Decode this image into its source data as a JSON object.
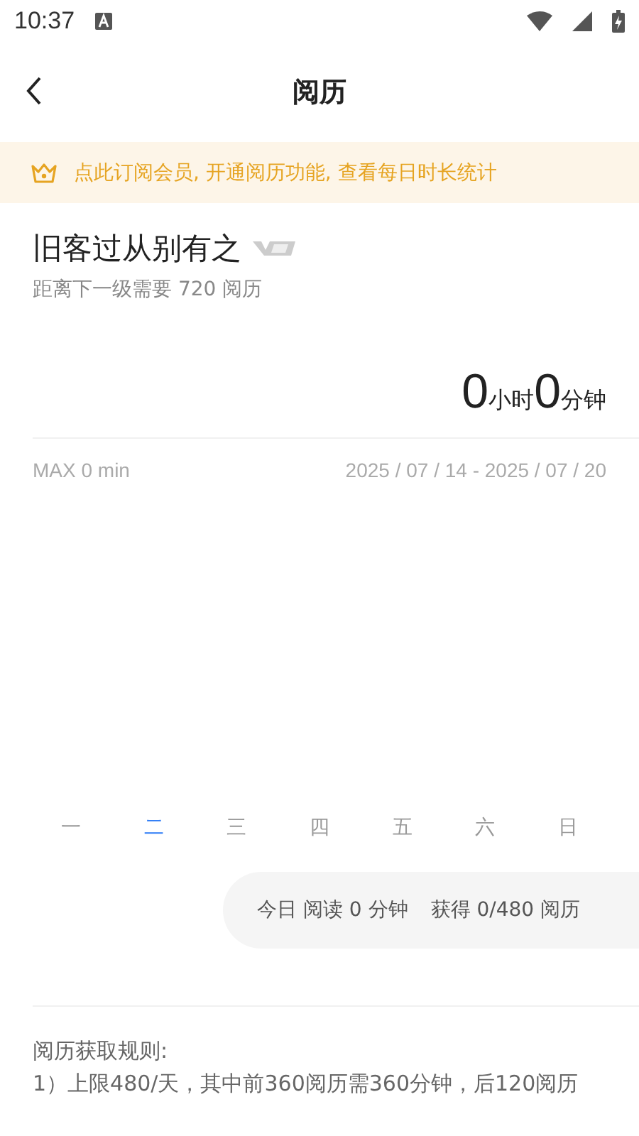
{
  "status_bar": {
    "time": "10:37"
  },
  "header": {
    "title": "阅历"
  },
  "banner": {
    "text": "点此订阅会员, 开通阅历功能, 查看每日时长统计"
  },
  "profile": {
    "name": "旧客过从别有之",
    "subtitle": "距离下一级需要 720 阅历"
  },
  "total": {
    "hours": "0",
    "hours_unit": "小时",
    "minutes": "0",
    "minutes_unit": "分钟"
  },
  "chart_info": {
    "max": "MAX 0 min",
    "range": "2025 / 07 / 14 - 2025 / 07 / 20"
  },
  "days": [
    {
      "label": "一",
      "selected": false
    },
    {
      "label": "二",
      "selected": true
    },
    {
      "label": "三",
      "selected": false
    },
    {
      "label": "四",
      "selected": false
    },
    {
      "label": "五",
      "selected": false
    },
    {
      "label": "六",
      "selected": false
    },
    {
      "label": "日",
      "selected": false
    }
  ],
  "today": {
    "reading": "今日 阅读 0 分钟",
    "earned": "获得 0/480 阅历"
  },
  "rules": {
    "title": "阅历获取规则:",
    "lines": [
      "1）上限480/天，其中前360阅历需360分钟，后120阅历"
    ]
  }
}
